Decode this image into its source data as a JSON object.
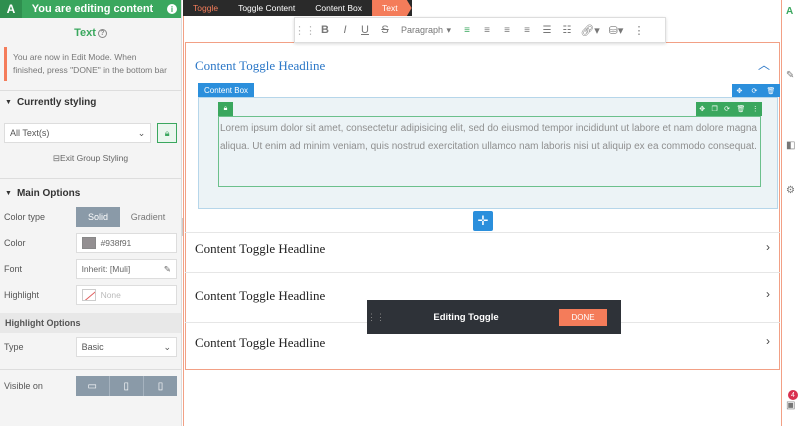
{
  "topbar": {
    "logo": "A",
    "title": "You are editing content",
    "info_icon": "info-icon"
  },
  "panel": {
    "title": "Text",
    "notice": "You are now in Edit Mode. When finished, press \"DONE\" in the bottom bar",
    "currently_styling": {
      "heading": "Currently styling",
      "selector_value": "All Text(s)",
      "exit_group": "Exit Group Styling"
    },
    "main_options": {
      "heading": "Main Options",
      "color_type_label": "Color type",
      "color_type_options": [
        "Solid",
        "Gradient"
      ],
      "color_label": "Color",
      "color_value": "#938f91",
      "font_label": "Font",
      "font_value": "Inherit: [Muli]",
      "highlight_label": "Highlight",
      "highlight_value": "None"
    },
    "highlight_options": {
      "heading": "Highlight Options",
      "type_label": "Type",
      "type_value": "Basic",
      "visible_label": "Visible on"
    }
  },
  "breadcrumbs": [
    "Toggle",
    "Toggle Content",
    "Content Box",
    "Text"
  ],
  "rte": {
    "paragraph_label": "Paragraph"
  },
  "content": {
    "toggles": [
      {
        "headline": "Content Toggle Headline"
      },
      {
        "headline": "Content Toggle Headline"
      },
      {
        "headline": "Content Toggle Headline"
      },
      {
        "headline": "Content Toggle Headline"
      }
    ],
    "content_box_label": "Content Box",
    "lorem": "Lorem ipsum dolor sit amet, consectetur adipisicing elit, sed do eiusmod tempor incididunt ut labore et nam dolore magna aliqua. Ut enim ad minim veniam, quis nostrud exercitation ullamco nam laboris nisi ut aliquip ex ea commodo consequat."
  },
  "editbar": {
    "label": "Editing Toggle",
    "done": "DONE"
  },
  "right_strip": {
    "badge_count": "4"
  },
  "colors": {
    "accent_green": "#3aa75e",
    "accent_orange": "#f47c5a",
    "accent_blue": "#2b8fdc",
    "dark": "#2e3238"
  }
}
